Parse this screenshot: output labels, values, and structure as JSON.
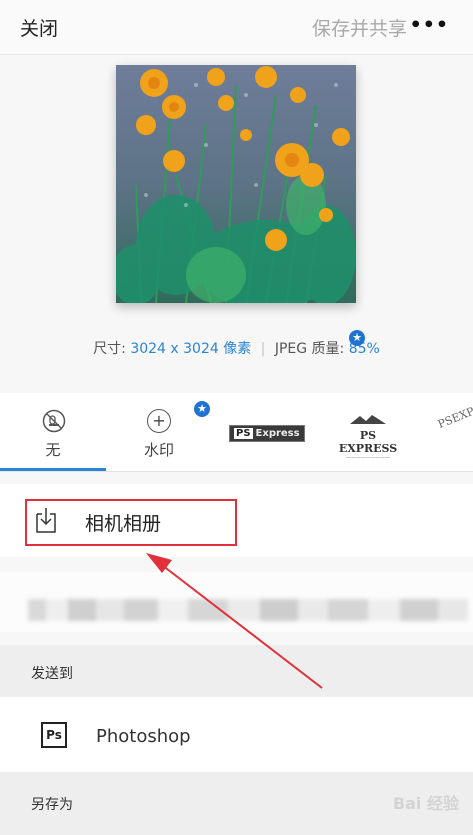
{
  "header": {
    "close_label": "关闭",
    "save_share_label": "保存并共享",
    "more_label": "•••"
  },
  "preview": {
    "size_label": "尺寸:",
    "size_value": "3024 x 3024 像素",
    "quality_label": "JPEG 质量:",
    "quality_value": "85%",
    "premium_badge": "★"
  },
  "watermark_options": {
    "items": [
      {
        "label": "无",
        "icon": "no-watermark-icon",
        "selected": true
      },
      {
        "label": "水印",
        "icon": "add-icon",
        "selected": false
      },
      {
        "label": "Express",
        "prefix": "PS",
        "icon": "ps-express-logo"
      },
      {
        "label": "PS EXPRESS",
        "icon": "ps-express-mountain-logo"
      },
      {
        "label": "PSEXP",
        "icon": "ps-express-tilted-logo"
      }
    ],
    "premium_badge": "★"
  },
  "camera_roll": {
    "label": "相机相册",
    "icon": "download-icon"
  },
  "send_to": {
    "heading": "发送到",
    "items": [
      {
        "label": "Photoshop",
        "icon_text": "Ps"
      }
    ]
  },
  "save_as": {
    "heading": "另存为"
  },
  "colors": {
    "accent": "#2a84d6",
    "highlight_border": "#e0303a",
    "premium_badge": "#1f74d2"
  },
  "site_watermark": "Bai 经验"
}
